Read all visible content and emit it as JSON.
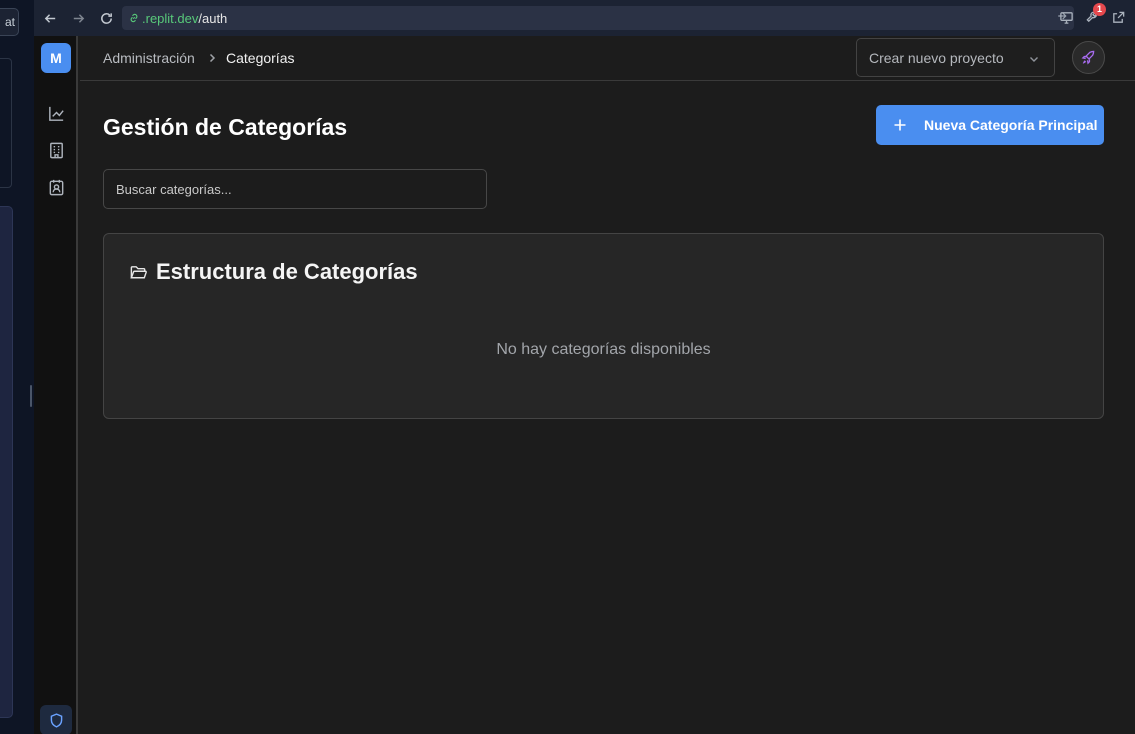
{
  "outer": {
    "chip_label": "at"
  },
  "browser": {
    "url_host": ".replit.dev",
    "url_path": "/auth",
    "badge_count": "1"
  },
  "sidebar": {
    "logo_letter": "M",
    "icons": [
      "chart-line-icon",
      "building-icon",
      "contact-card-icon"
    ],
    "bottom_icon": "shield-icon"
  },
  "breadcrumb": {
    "parent": "Administración",
    "current": "Categorías"
  },
  "topbar": {
    "project_select_placeholder": "Crear nuevo proyecto",
    "rocket_icon": "rocket-icon"
  },
  "page": {
    "title": "Gestión de Categorías",
    "new_button_label": "Nueva Categoría Principal",
    "search_placeholder": "Buscar categorías...",
    "card_title": "Estructura de Categorías",
    "empty_message": "No hay categorías disponibles"
  },
  "colors": {
    "accent": "#4a8ef0",
    "background": "#1c1c1c",
    "card": "#262626",
    "badge": "#e5484d",
    "rocket": "#a86cf0"
  }
}
